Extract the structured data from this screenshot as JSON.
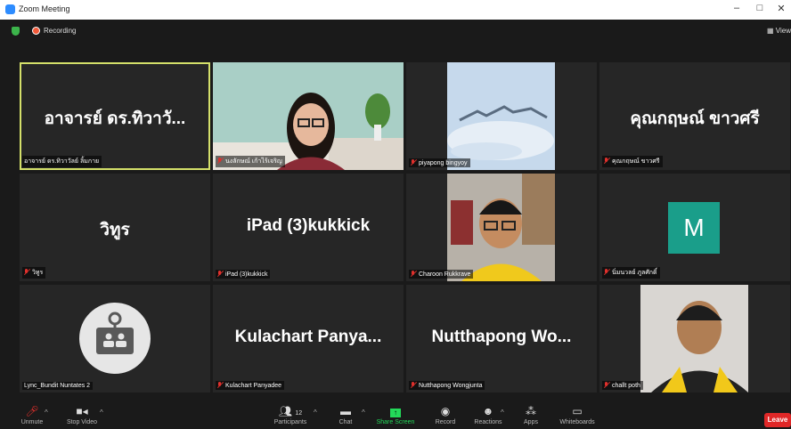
{
  "window": {
    "title": "Zoom Meeting",
    "minimize": "–",
    "maximize": "□",
    "close": "✕"
  },
  "topbar": {
    "recording_label": "Recording",
    "view_label": "View"
  },
  "tiles": [
    {
      "big": "อาจารย์ ดร.ทิวาวั...",
      "label": "อาจารย์ ดร.ทิวาวัลย์ ลิ้มกาย"
    },
    {
      "big": "",
      "label": "นงลักษณ์ เก้าไร้เจริญ"
    },
    {
      "big": "",
      "label": "piyapong bingyoy"
    },
    {
      "big": "คุณกฤษณ์ ขาวศรี",
      "label": "คุณกฤษณ์ ขาวศรี"
    },
    {
      "big": "วิทูร",
      "label": "วิทูร"
    },
    {
      "big": "iPad (3)kukkick",
      "label": "iPad (3)kukkick"
    },
    {
      "big": "",
      "label": "Charoon Rukkrave"
    },
    {
      "big": "",
      "label": "นิ่มนวลย์ ภูลศักดิ์",
      "avatar_letter": "M"
    },
    {
      "big": "",
      "label": "Lync_Bundit Nuntates 2"
    },
    {
      "big": "Kulachart Panya...",
      "label": "Kulachart Panyadee"
    },
    {
      "big": "Nutthapong Wo...",
      "label": "Nutthapong Wongjunta"
    },
    {
      "big": "",
      "label": "challt poth"
    }
  ],
  "toolbar": {
    "unmute": "Unmute",
    "stop_video": "Stop Video",
    "participants": "Participants",
    "participants_count": "12",
    "chat": "Chat",
    "share_screen": "Share Screen",
    "record": "Record",
    "reactions": "Reactions",
    "apps": "Apps",
    "whiteboards": "Whiteboards",
    "leave": "Leave"
  },
  "colors": {
    "active_border": "#d4e06a",
    "share_green": "#23d959",
    "leave_red": "#e02828",
    "avatar_teal": "#1a9e8a"
  }
}
